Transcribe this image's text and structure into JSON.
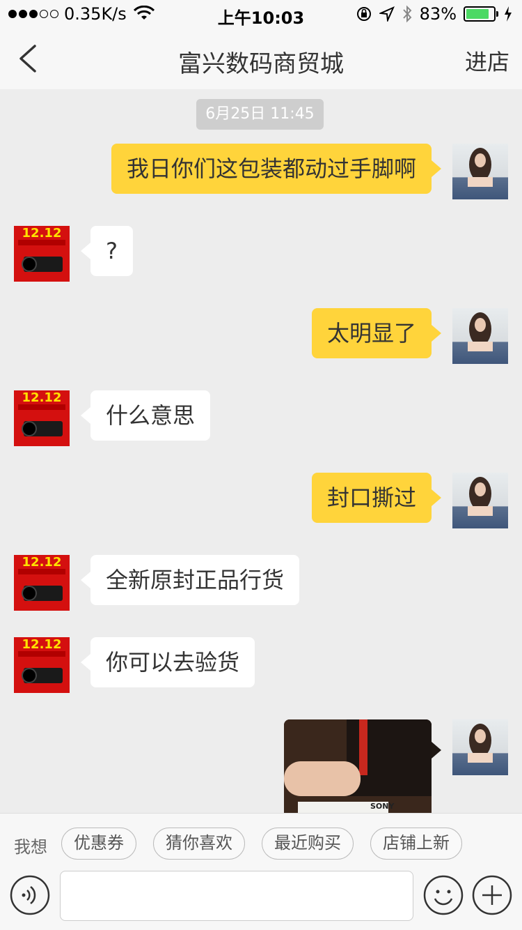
{
  "status_bar": {
    "signal": "●●●○○",
    "speed": "0.35K/s",
    "time": "上午10:03",
    "battery_percent": "83%",
    "battery_level": 0.83
  },
  "nav": {
    "title": "富兴数码商贸城",
    "enter_store": "进店"
  },
  "chat": {
    "timestamp": "6月25日 11:45",
    "shop_avatar_text": "12.12",
    "messages": [
      {
        "from": "me",
        "text": "我日你们这包装都动过手脚啊"
      },
      {
        "from": "shop",
        "text": "?"
      },
      {
        "from": "me",
        "text": "太明显了"
      },
      {
        "from": "shop",
        "text": "什么意思"
      },
      {
        "from": "me",
        "text": "封口撕过"
      },
      {
        "from": "shop",
        "text": "全新原封正品行货"
      },
      {
        "from": "shop",
        "text": "你可以去验货"
      }
    ],
    "photo_label": "SONY"
  },
  "bottom": {
    "suggest_label": "我想",
    "chips": [
      "优惠券",
      "猜你喜欢",
      "最近购买",
      "店铺上新"
    ],
    "input_value": ""
  },
  "colors": {
    "my_bubble": "#ffd43b",
    "shop_bubble": "#ffffff",
    "background": "#ededed",
    "battery": "#4cd964"
  }
}
